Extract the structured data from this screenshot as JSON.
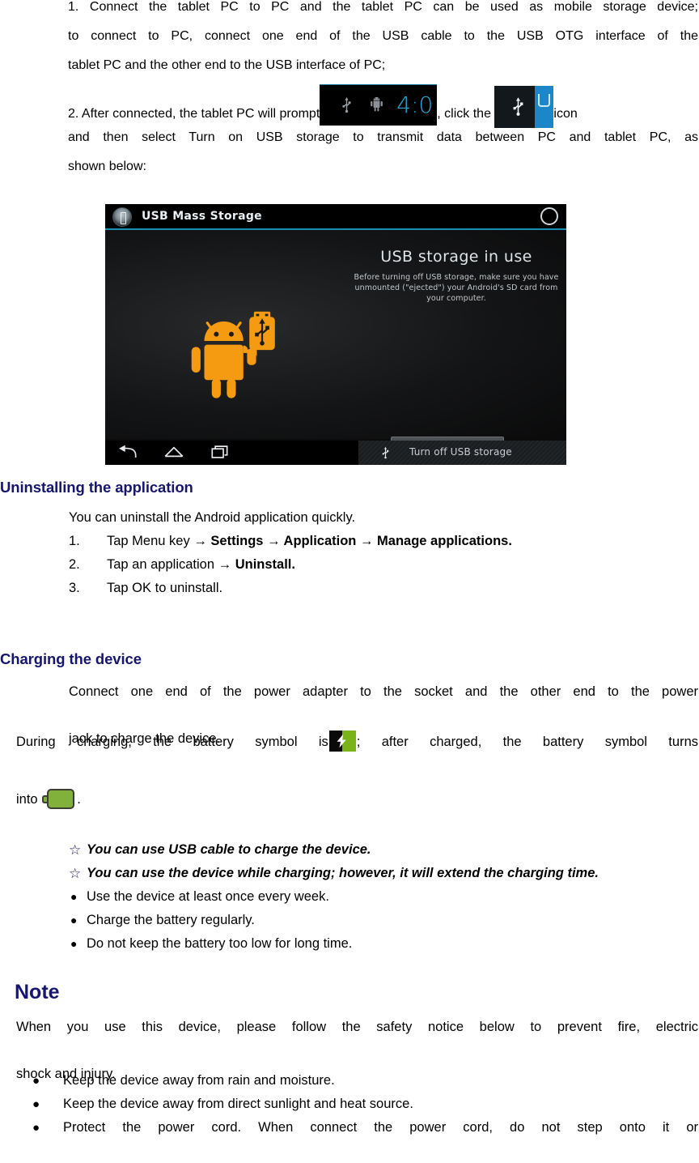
{
  "document": {
    "steps": {
      "step1": {
        "text": "1. Connect the tablet PC to PC and the tablet PC can be used as mobile storage device; to connect to PC, connect one end of the USB cable to the USB OTG interface of the tablet PC and the other end to the USB interface of PC;",
        "line1": "1. Connect the tablet PC to PC and the tablet PC can be used as mobile storage device;",
        "line2": "to connect to PC, connect one end of the USB cable to the USB OTG interface of the",
        "line3": "tablet PC and the other end to the USB interface of PC;"
      },
      "step2": {
        "part1": "2. After connected, the tablet PC will prompt",
        "part2": ", click the",
        "part3": "icon",
        "line2": "and then select Turn on USB storage to transmit data between PC and tablet PC, as",
        "line3": "shown below:"
      }
    },
    "inline_images": {
      "status_bar": {
        "name": "android-status-bar-notification",
        "time_text": "4:0",
        "time_color": "#29a8d6",
        "background": "#000000",
        "icons": [
          "usb-icon",
          "android-robot-icon"
        ]
      },
      "usb_notification_icon": {
        "name": "usb-notification-icon",
        "background": "#13181c",
        "accent_color": "#1b87c9",
        "icons": [
          "usb-icon"
        ]
      },
      "battery_charging": {
        "name": "battery-charging-icon",
        "fill_color": "#7ab317",
        "background": "#0a0a0a"
      },
      "battery_full": {
        "name": "battery-full-icon",
        "fill_color": "#81b03b",
        "border_color": "#3d3f34"
      }
    },
    "android_screenshot": {
      "title_bar": {
        "title": "USB Mass Storage",
        "accent_color": "#1a8fb5"
      },
      "content": {
        "heading": "USB storage in use",
        "description": "Before turning off USB storage, make sure you have unmounted (\"ejected\") your Android's SD card from your computer.",
        "button_label": "Turn off USB storage",
        "robot_color": "#f59b11"
      },
      "nav_bar": {
        "icons": [
          "back-icon",
          "home-icon",
          "recents-icon"
        ],
        "notification_label": "Turn off USB storage"
      }
    },
    "uninstall_section": {
      "heading": "Uninstalling the application",
      "intro": "You can uninstall the Android application quickly.",
      "steps": [
        {
          "num": "1.",
          "plain": "Tap Menu key ",
          "bold": "→ Settings → Application → Manage applications."
        },
        {
          "num": "2.",
          "plain": "Tap an application ",
          "bold": "→ Uninstall."
        },
        {
          "num": "3.",
          "plain": "Tap OK to uninstall.",
          "bold": ""
        }
      ]
    },
    "charging_section": {
      "heading": "Charging the device",
      "para_line1": "Connect one end of the power adapter to the socket and the other end to the power",
      "para_line2": "jack to charge the device.",
      "symbol_line_part1": "During charging, the battery symbol is",
      "symbol_line_part2": "; after charged, the battery symbol turns",
      "symbol_line_part3": "into",
      "symbol_line_part4": ".",
      "tips": [
        {
          "bullet": "☆",
          "style": "star",
          "text": "You can use USB cable to charge the device."
        },
        {
          "bullet": "☆",
          "style": "star",
          "text": "You can use the device while charging; however, it will extend the charging time."
        },
        {
          "bullet": "●",
          "style": "dot",
          "text": "Use the device at least once every week."
        },
        {
          "bullet": "●",
          "style": "dot",
          "text": "Charge the battery regularly."
        },
        {
          "bullet": "●",
          "style": "dot",
          "text": "Do not keep the battery too low for long time."
        }
      ]
    },
    "note_section": {
      "heading": "Note",
      "intro_line1": "When you use this device, please follow the safety notice below to prevent fire, electric",
      "intro_line2": "shock and injury.",
      "items": [
        "Keep the device away from rain and moisture.",
        "Keep the device away from direct sunlight and heat source.",
        "Protect the power cord. When connect the power cord, do not step onto it or"
      ]
    },
    "colors": {
      "heading": "#16166e",
      "body_text": "#000000",
      "page_background": "#ffffff"
    }
  }
}
